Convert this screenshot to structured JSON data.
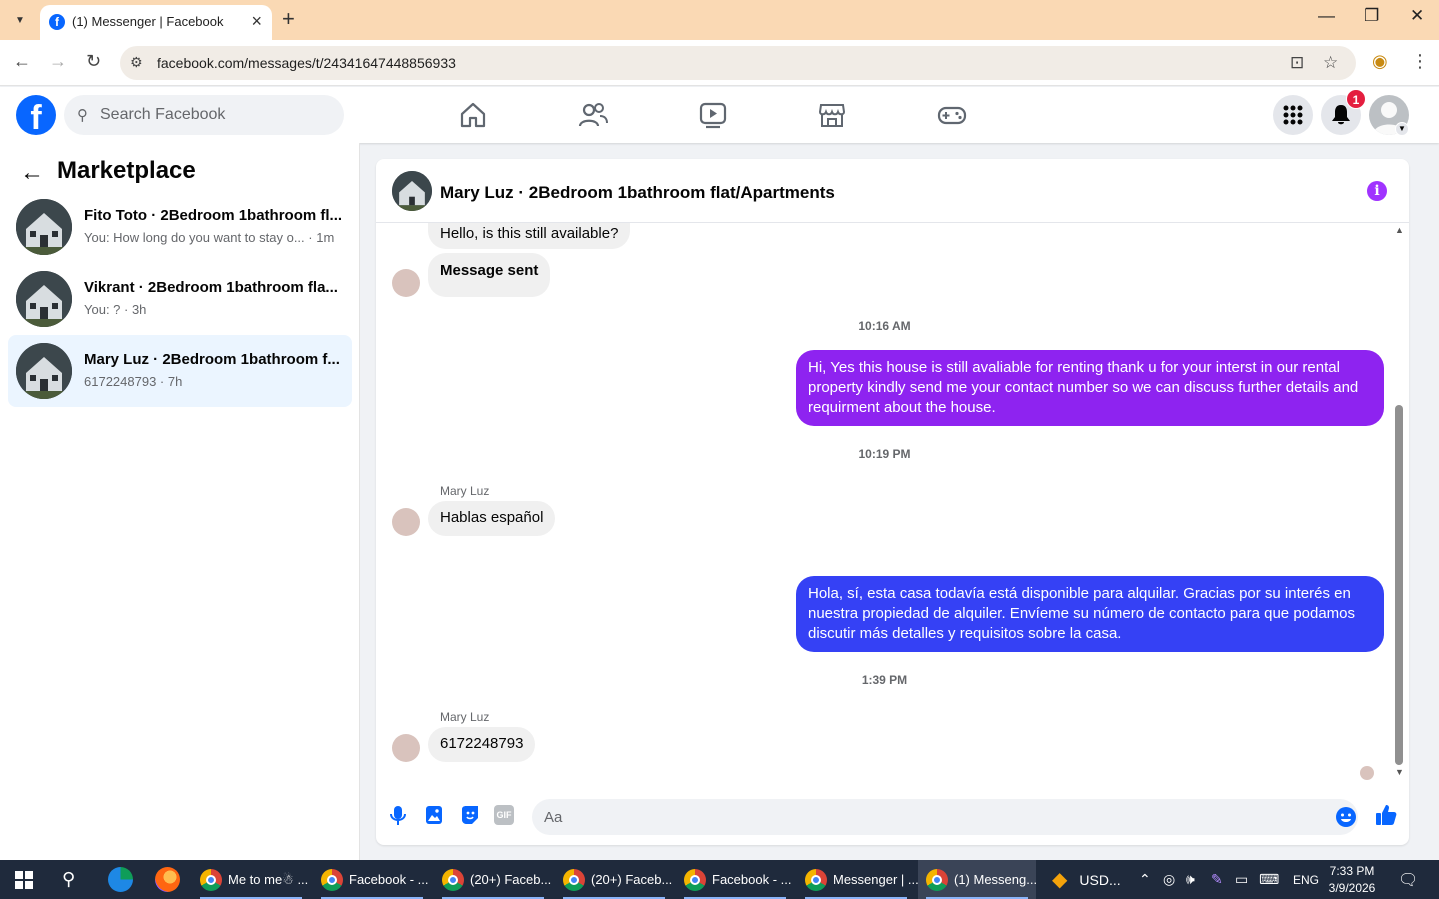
{
  "browser": {
    "tab_title": "(1) Messenger | Facebook",
    "tab_favicon": "f",
    "url": "facebook.com/messages/t/24341647448856933"
  },
  "header": {
    "logo": "f",
    "search_placeholder": "Search Facebook",
    "notification_count": "1"
  },
  "sidebar": {
    "title": "Marketplace",
    "conversations": [
      {
        "name": "Fito Toto · 2Bedroom 1bathroom fl...",
        "preview": "You: How long do you want to stay o... · 1m"
      },
      {
        "name": "Vikrant · 2Bedroom 1bathroom fla...",
        "preview": "You: ? · 3h"
      },
      {
        "name": "Mary Luz · 2Bedroom 1bathroom f...",
        "preview": "6172248793 · 7h"
      }
    ]
  },
  "chat": {
    "title": "Mary Luz · 2Bedroom 1bathroom flat/Apartments",
    "info_icon": "i",
    "messages": {
      "in1": "Hello, is this still available?",
      "in2": "Message sent",
      "ts1": "10:16 AM",
      "out1": "Hi, Yes this house is still avaliable for renting thank u for your interst in our rental property kindly send me your contact number so we can discuss further details and requirment about the house.",
      "ts2": "10:19 PM",
      "sender1": "Mary Luz",
      "in3": "Hablas español",
      "out2": "Hola, sí, esta casa todavía está disponible para alquilar. Gracias por su interés en nuestra propiedad de alquiler. Envíeme su número de contacto para que podamos discutir más detalles y requisitos sobre la casa.",
      "ts3": "1:39 PM",
      "sender2": "Mary Luz",
      "in4": "6172248793"
    },
    "composer_placeholder": "Aa",
    "gif_label": "GIF"
  },
  "taskbar": {
    "items": [
      "Me to me☃ ...",
      "Facebook - ...",
      "(20+) Faceb...",
      "(20+) Faceb...",
      "Facebook - ...",
      "Messenger | ...",
      "(1) Messeng..."
    ],
    "weather": "USD...",
    "lang": "ENG",
    "time": "7:33 PM",
    "date": "3/9/2026"
  },
  "colors": {
    "facebook_blue": "#0866ff",
    "out_purple": "#8e23f0",
    "out_blue": "#3541f5",
    "active_row": "#ebf5ff",
    "tab_strip": "#fad9b4"
  }
}
